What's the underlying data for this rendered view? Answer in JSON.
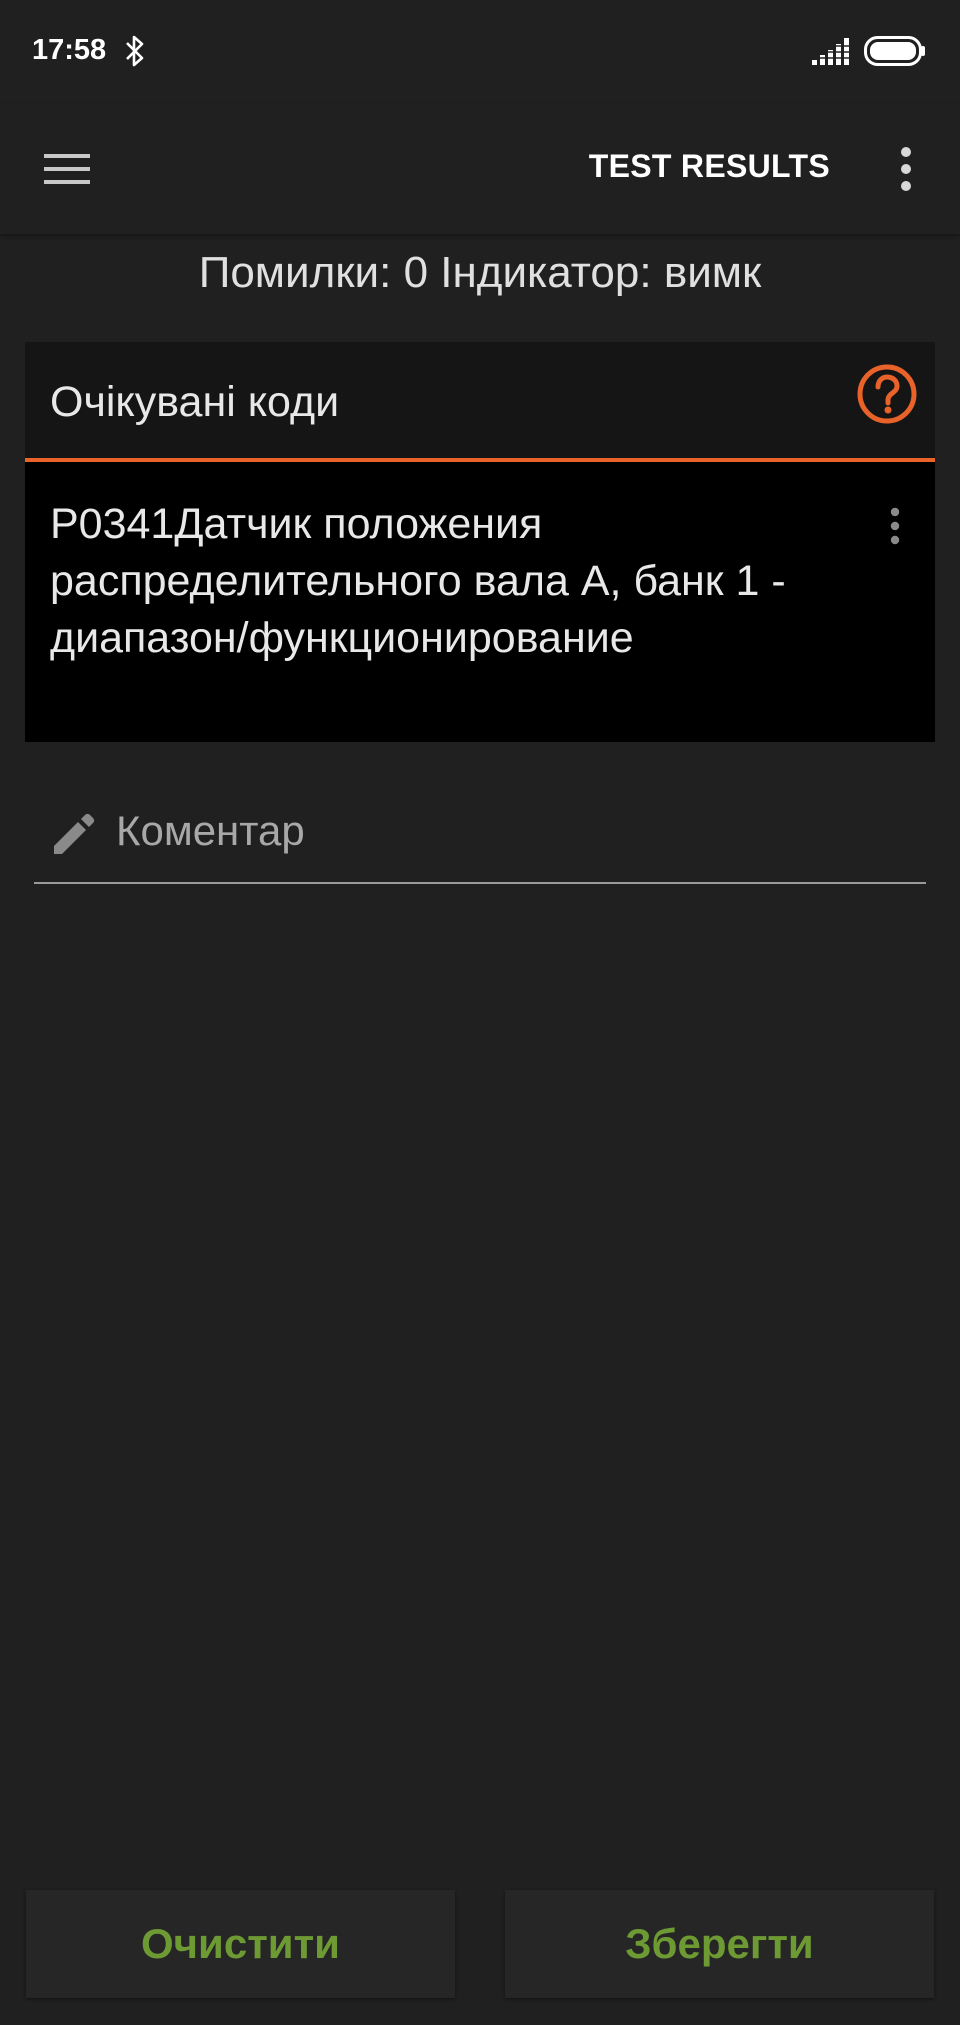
{
  "status_bar": {
    "time": "17:58",
    "icons": [
      "bluetooth-icon",
      "signal-icon",
      "battery-icon"
    ]
  },
  "app_bar": {
    "title": "TEST RESULTS",
    "icons": [
      "menu-icon",
      "overflow-menu-icon"
    ]
  },
  "summary": {
    "text": "Помилки: 0 Індикатор: вимк"
  },
  "expected_codes": {
    "title": "Очікувані коди",
    "help_icon": "help-circle-icon",
    "items": [
      {
        "text": "P0341Датчик положения распределительного вала А, банк 1 - диапазон/функционирование",
        "menu_icon": "item-overflow-icon"
      }
    ]
  },
  "comment": {
    "placeholder": "Коментар",
    "value": "",
    "icon": "pencil-icon"
  },
  "buttons": {
    "clear_label": "Очистити",
    "save_label": "Зберегти"
  },
  "colors": {
    "background": "#202020",
    "card_background": "#000000",
    "accent": "#e8622a",
    "button_text": "#6e9a34",
    "text": "#e8e8e8"
  }
}
